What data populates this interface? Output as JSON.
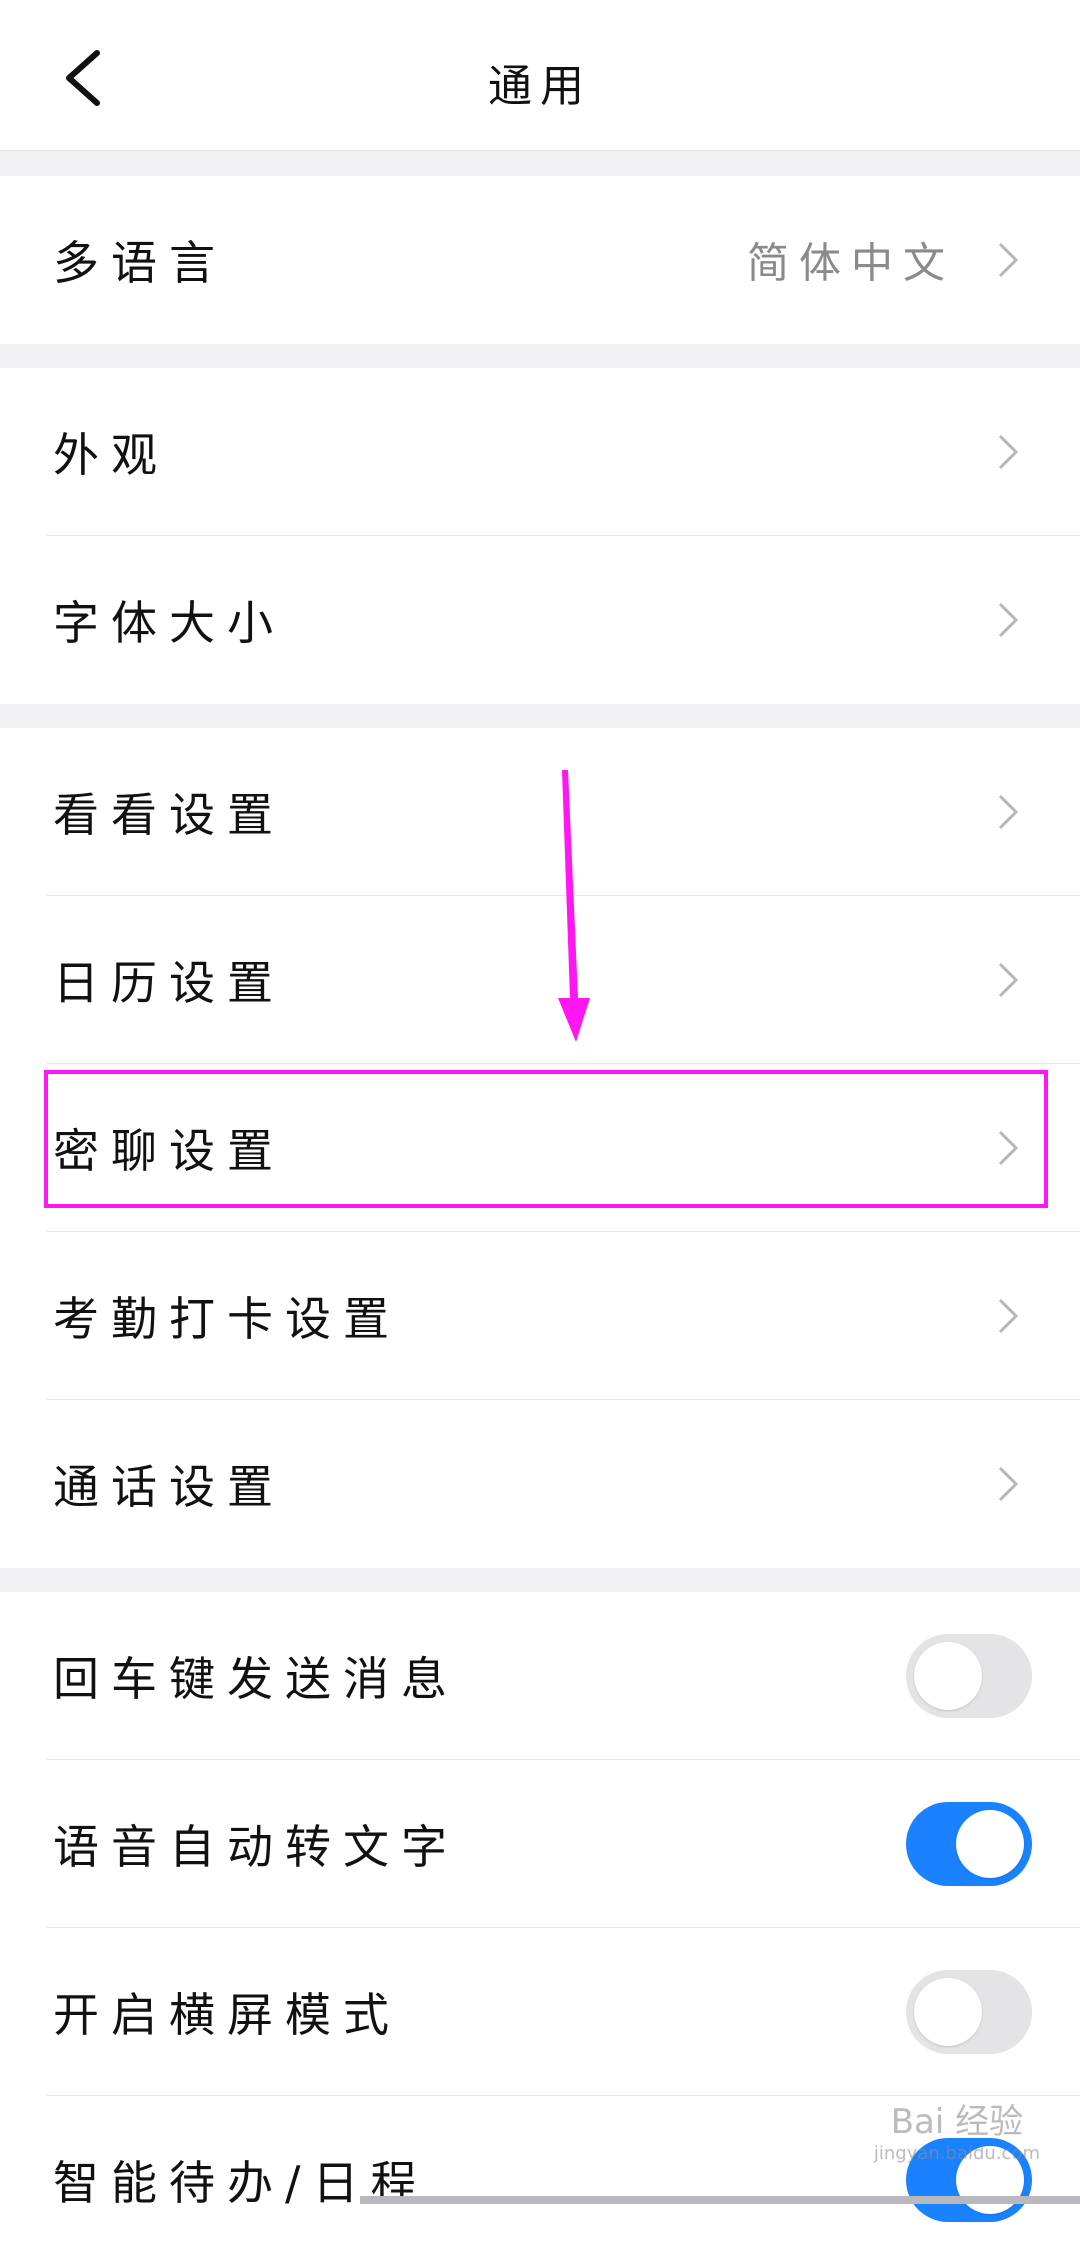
{
  "header": {
    "title": "通用",
    "back_icon": "chevron-left-icon"
  },
  "groups": [
    {
      "rows": [
        {
          "label": "多语言",
          "value": "简体中文"
        }
      ]
    },
    {
      "rows": [
        {
          "label": "外观"
        },
        {
          "label": "字体大小"
        }
      ]
    },
    {
      "rows": [
        {
          "label": "看看设置"
        },
        {
          "label": "日历设置"
        },
        {
          "label": "密聊设置"
        },
        {
          "label": "考勤打卡设置"
        },
        {
          "label": "通话设置"
        }
      ]
    },
    {
      "toggles": [
        {
          "label": "回车键发送消息",
          "on": false
        },
        {
          "label": "语音自动转文字",
          "on": true
        },
        {
          "label": "开启横屏模式",
          "on": false
        },
        {
          "label": "智能待办/日程",
          "on": true
        }
      ]
    }
  ],
  "colors": {
    "accent": "#1a82ff",
    "highlight": "#ff16f0",
    "toggle_off": "#e4e4e6"
  },
  "watermark": {
    "main": "Bai 经验",
    "sub": "jingyan.baidu.com"
  }
}
